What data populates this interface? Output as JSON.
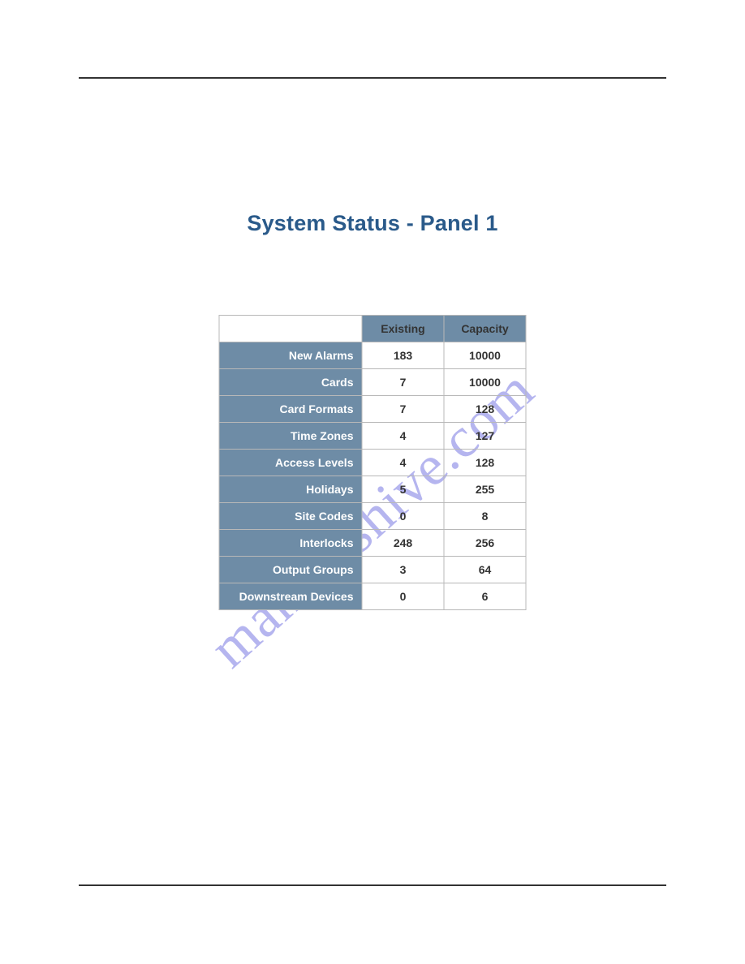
{
  "title": "System Status - Panel 1",
  "columns": [
    "Existing",
    "Capacity"
  ],
  "rows": [
    {
      "label": "New Alarms",
      "existing": "183",
      "capacity": "10000"
    },
    {
      "label": "Cards",
      "existing": "7",
      "capacity": "10000"
    },
    {
      "label": "Card Formats",
      "existing": "7",
      "capacity": "128"
    },
    {
      "label": "Time Zones",
      "existing": "4",
      "capacity": "127"
    },
    {
      "label": "Access Levels",
      "existing": "4",
      "capacity": "128"
    },
    {
      "label": "Holidays",
      "existing": "5",
      "capacity": "255"
    },
    {
      "label": "Site Codes",
      "existing": "0",
      "capacity": "8"
    },
    {
      "label": "Interlocks",
      "existing": "248",
      "capacity": "256"
    },
    {
      "label": "Output Groups",
      "existing": "3",
      "capacity": "64"
    },
    {
      "label": "Downstream Devices",
      "existing": "0",
      "capacity": "6"
    }
  ],
  "watermark": "manualshive.com"
}
